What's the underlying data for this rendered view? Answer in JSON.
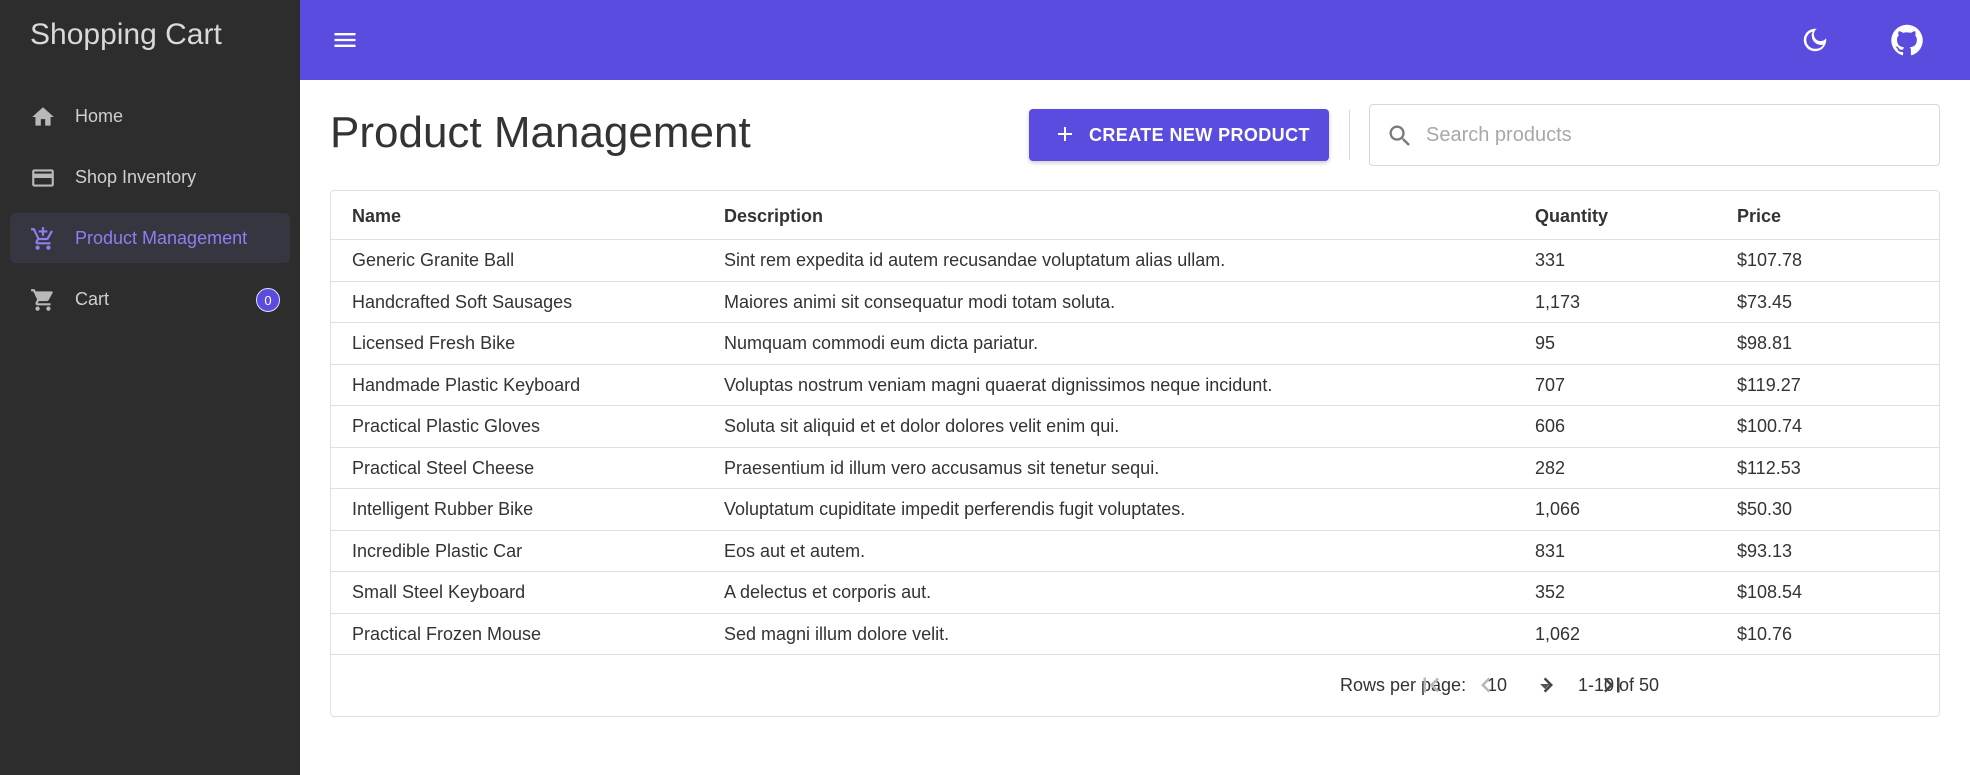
{
  "sidebar": {
    "app_title": "Shopping Cart",
    "items": [
      {
        "label": "Home",
        "icon": "home-icon"
      },
      {
        "label": "Shop Inventory",
        "icon": "credit-card-icon"
      },
      {
        "label": "Product Management",
        "icon": "cart-plus-icon",
        "active": true
      },
      {
        "label": "Cart",
        "icon": "cart-icon",
        "badge": "0"
      }
    ]
  },
  "header": {
    "menu_icon": "menu-icon",
    "theme_icon": "moon-icon",
    "github_icon": "github-icon",
    "brand_color": "#5b4ce0"
  },
  "main": {
    "title": "Product Management",
    "create_button": "CREATE NEW PRODUCT",
    "search_placeholder": "Search products",
    "table": {
      "columns": [
        "Name",
        "Description",
        "Quantity",
        "Price"
      ],
      "rows": [
        [
          "Generic Granite Ball",
          "Sint rem expedita id autem recusandae voluptatum alias ullam.",
          "331",
          "$107.78"
        ],
        [
          "Handcrafted Soft Sausages",
          "Maiores animi sit consequatur modi totam soluta.",
          "1,173",
          "$73.45"
        ],
        [
          "Licensed Fresh Bike",
          "Numquam commodi eum dicta pariatur.",
          "95",
          "$98.81"
        ],
        [
          "Handmade Plastic Keyboard",
          "Voluptas nostrum veniam magni quaerat dignissimos neque incidunt.",
          "707",
          "$119.27"
        ],
        [
          "Practical Plastic Gloves",
          "Soluta sit aliquid et et dolor dolores velit enim qui.",
          "606",
          "$100.74"
        ],
        [
          "Practical Steel Cheese",
          "Praesentium id illum vero accusamus sit tenetur sequi.",
          "282",
          "$112.53"
        ],
        [
          "Intelligent Rubber Bike",
          "Voluptatum cupiditate impedit perferendis fugit voluptates.",
          "1,066",
          "$50.30"
        ],
        [
          "Incredible Plastic Car",
          "Eos aut et autem.",
          "831",
          "$93.13"
        ],
        [
          "Small Steel Keyboard",
          "A delectus et corporis aut.",
          "352",
          "$108.54"
        ],
        [
          "Practical Frozen Mouse",
          "Sed magni illum dolore velit.",
          "1,062",
          "$10.76"
        ]
      ]
    },
    "pagination": {
      "rows_per_page_label": "Rows per page:",
      "rows_per_page_value": "10",
      "range_text": "1-10 of 50"
    }
  }
}
